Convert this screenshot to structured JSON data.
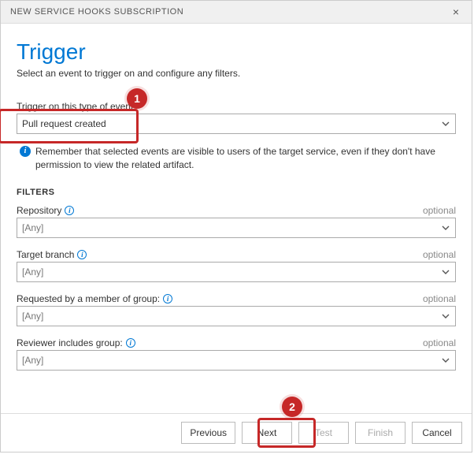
{
  "titlebar": {
    "title": "NEW SERVICE HOOKS SUBSCRIPTION",
    "close": "×"
  },
  "header": {
    "title": "Trigger",
    "subtitle": "Select an event to trigger on and configure any filters."
  },
  "event": {
    "label": "Trigger on this type of event",
    "value": "Pull request created"
  },
  "info": {
    "text": "Remember that selected events are visible to users of the target service, even if they don't have permission to view the related artifact."
  },
  "filters_header": "FILTERS",
  "optional_label": "optional",
  "filters": {
    "repository": {
      "label": "Repository",
      "value": "[Any]"
    },
    "branch": {
      "label": "Target branch",
      "value": "[Any]"
    },
    "requested_by": {
      "label": "Requested by a member of group:",
      "value": "[Any]"
    },
    "reviewer": {
      "label": "Reviewer includes group:",
      "value": "[Any]"
    }
  },
  "buttons": {
    "previous": "Previous",
    "next": "Next",
    "test": "Test",
    "finish": "Finish",
    "cancel": "Cancel"
  },
  "callouts": {
    "one": "1",
    "two": "2"
  }
}
